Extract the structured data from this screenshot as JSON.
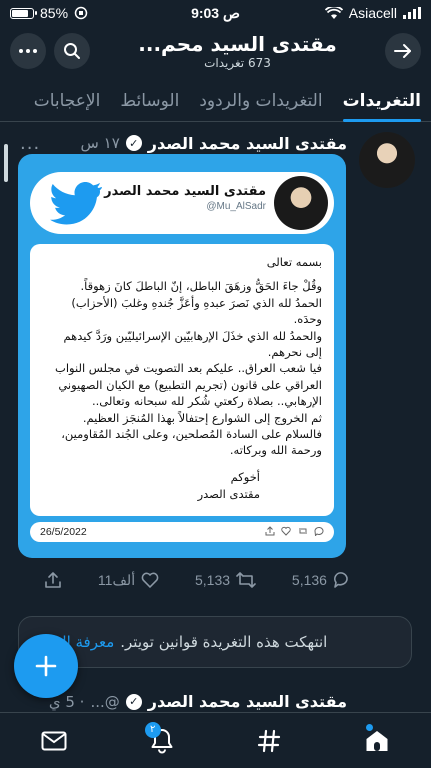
{
  "status": {
    "battery": "85%",
    "battery_level": 0.85,
    "time": "9:03 ص",
    "carrier": "Asiacell"
  },
  "header": {
    "title": "مقتدى السيد محم...",
    "subtitle": "673 تغريدات"
  },
  "tabs": [
    {
      "label": "التغريدات",
      "active": true
    },
    {
      "label": "التغريدات والردود",
      "active": false
    },
    {
      "label": "الوسائط",
      "active": false
    },
    {
      "label": "الإعجابات",
      "active": false
    }
  ],
  "tweet": {
    "name": "مقتدى السيد محمد الصدر",
    "time": "١٧ س",
    "more": "...",
    "image": {
      "name": "مقتدى السيد محمد الصدر",
      "handle": "@Mu_AlSadr",
      "lines": [
        "بسمه تعالى",
        "وقُلْ جاءَ الحَقُّ وزهَقَ الباطل، إنّ الباطلَ كانَ زهوقاً.",
        "الحمدُ لله الذي نَصرَ عبدهِ وأعَزَّ جُندهِ وغلبَ (الأحزاب) وحدَه.",
        "والحمدُ لله الذي خذَلَ الإرهابيّين الإسرائيليّين ورَدَّ كيدهم",
        "إلى نحرهم.",
        "فيا شعب العراق.. عليكم بعد التصويت في مجلس النواب",
        "العراقي على قانون (تجريم التطبيع) مع الكيان الصهيوني",
        "الإرهابي.. بصلاة ركعتي شُكر لله سبحانه وتعالى..",
        "ثم الخروج إلى الشوارع إحتفالاً بهذا المُنجَز العظيم.",
        "فالسلام على السادة المُصلحين، وعلى الجُند المُقاومين،",
        "ورحمة الله وبركاته."
      ],
      "signoff_1": "أخوكم",
      "signoff_2": "مقتدى الصدر",
      "date": "26/5/2022"
    },
    "replies": "5,136",
    "retweets": "5,133",
    "likes": "11ألف"
  },
  "notice": {
    "text": "انتهكت هذه التغريدة قوانين تويتر.",
    "link": "معرفة المزيد"
  },
  "next_tweet": {
    "name": "مقتدى السيد محمد الصدر",
    "handle": "@...",
    "time": "· 5 ي"
  },
  "bottom_nav": {
    "notifications_badge": "٢"
  },
  "colors": {
    "background": "#15202b",
    "accent": "#1d9bf0",
    "image_bg": "#2ea4e8"
  }
}
